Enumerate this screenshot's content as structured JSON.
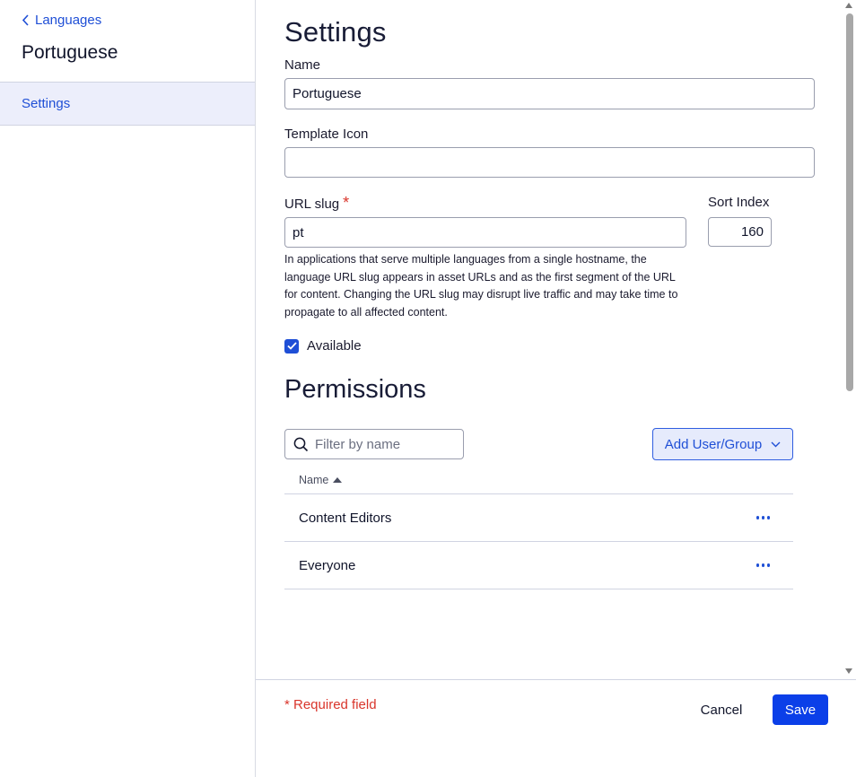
{
  "sidebar": {
    "back_label": "Languages",
    "title": "Portuguese",
    "nav_items": [
      {
        "label": "Settings",
        "active": true
      }
    ]
  },
  "settings": {
    "heading": "Settings",
    "name_label": "Name",
    "name_value": "Portuguese",
    "template_icon_label": "Template Icon",
    "template_icon_value": "",
    "url_slug_label": "URL slug",
    "url_slug_required_mark": "*",
    "url_slug_value": "pt",
    "sort_index_label": "Sort Index",
    "sort_index_value": "160",
    "url_slug_help": "In applications that serve multiple languages from a single hostname, the language URL slug appears in asset URLs and as the first segment of the URL for content. Changing the URL slug may disrupt live traffic and may take time to propagate to all affected content.",
    "available_label": "Available",
    "available_checked": true
  },
  "permissions": {
    "heading": "Permissions",
    "filter_placeholder": "Filter by name",
    "add_button_label": "Add User/Group",
    "column_name": "Name",
    "sort_direction": "ascending",
    "rows": [
      {
        "name": "Content Editors"
      },
      {
        "name": "Everyone"
      }
    ]
  },
  "footer": {
    "required_note": "* Required field",
    "cancel_label": "Cancel",
    "save_label": "Save"
  },
  "colors": {
    "accent": "#1f4fd6",
    "primary_button": "#0b3fe8",
    "required": "#d9352b",
    "nav_active_bg": "#eceefb"
  }
}
